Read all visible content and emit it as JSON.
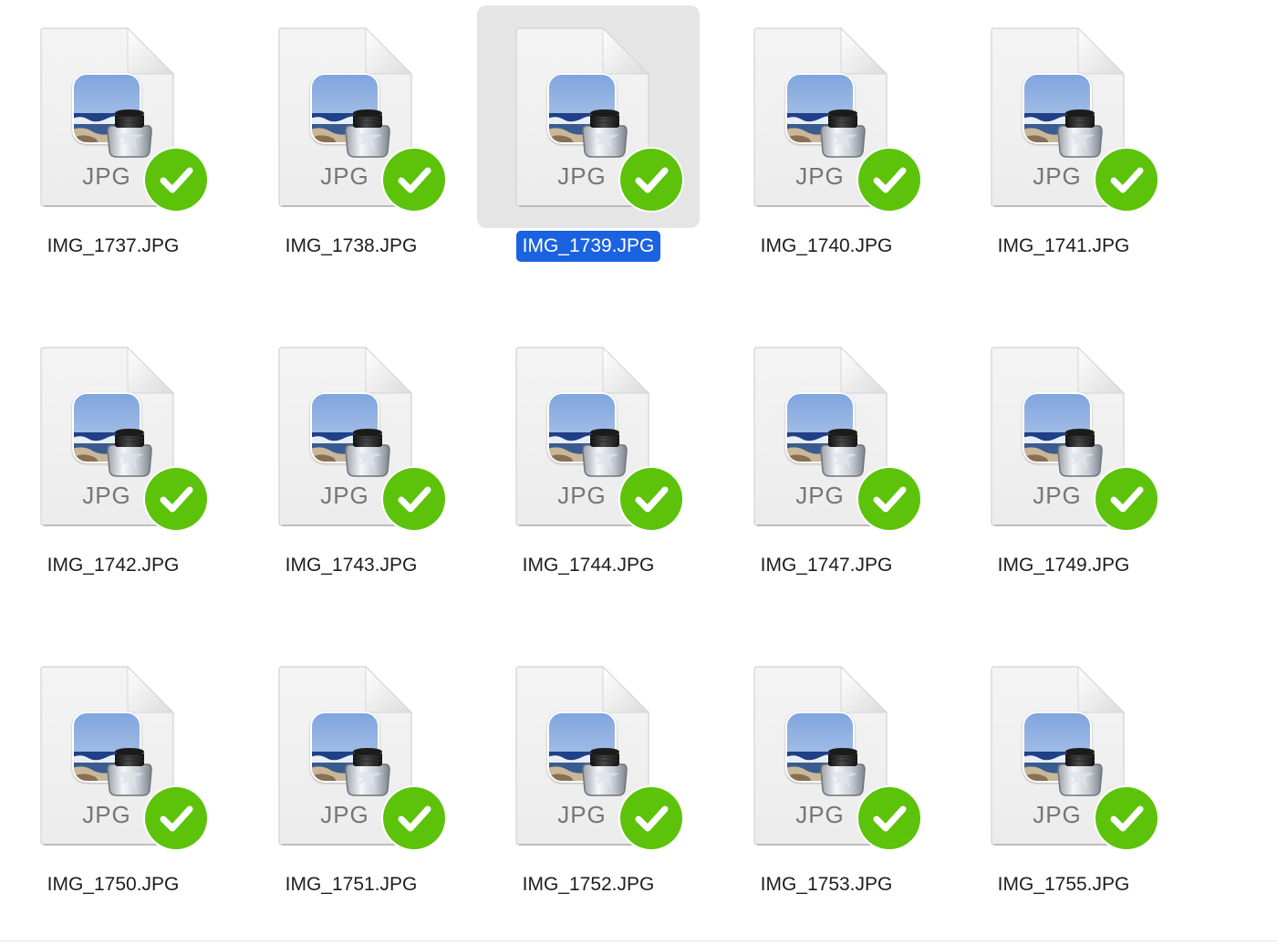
{
  "files": [
    {
      "name": "IMG_1737.JPG",
      "ext": "JPG",
      "status": "synced",
      "selected": false
    },
    {
      "name": "IMG_1738.JPG",
      "ext": "JPG",
      "status": "synced",
      "selected": false
    },
    {
      "name": "IMG_1739.JPG",
      "ext": "JPG",
      "status": "synced",
      "selected": true
    },
    {
      "name": "IMG_1740.JPG",
      "ext": "JPG",
      "status": "synced",
      "selected": false
    },
    {
      "name": "IMG_1741.JPG",
      "ext": "JPG",
      "status": "synced",
      "selected": false
    },
    {
      "name": "IMG_1742.JPG",
      "ext": "JPG",
      "status": "synced",
      "selected": false
    },
    {
      "name": "IMG_1743.JPG",
      "ext": "JPG",
      "status": "synced",
      "selected": false
    },
    {
      "name": "IMG_1744.JPG",
      "ext": "JPG",
      "status": "synced",
      "selected": false
    },
    {
      "name": "IMG_1747.JPG",
      "ext": "JPG",
      "status": "synced",
      "selected": false
    },
    {
      "name": "IMG_1749.JPG",
      "ext": "JPG",
      "status": "synced",
      "selected": false
    },
    {
      "name": "IMG_1750.JPG",
      "ext": "JPG",
      "status": "synced",
      "selected": false
    },
    {
      "name": "IMG_1751.JPG",
      "ext": "JPG",
      "status": "synced",
      "selected": false
    },
    {
      "name": "IMG_1752.JPG",
      "ext": "JPG",
      "status": "synced",
      "selected": false
    },
    {
      "name": "IMG_1753.JPG",
      "ext": "JPG",
      "status": "synced",
      "selected": false
    },
    {
      "name": "IMG_1755.JPG",
      "ext": "JPG",
      "status": "synced",
      "selected": false
    }
  ],
  "icons": {
    "file": "jpg-document-icon",
    "thumbnail": "preview-app-icon",
    "status": "checkmark-icon"
  },
  "colors": {
    "selection_tile": "#e5e5e5",
    "selection_label": "#1a62e0",
    "sync_badge": "#5cc20a",
    "extension_text": "#767676"
  }
}
